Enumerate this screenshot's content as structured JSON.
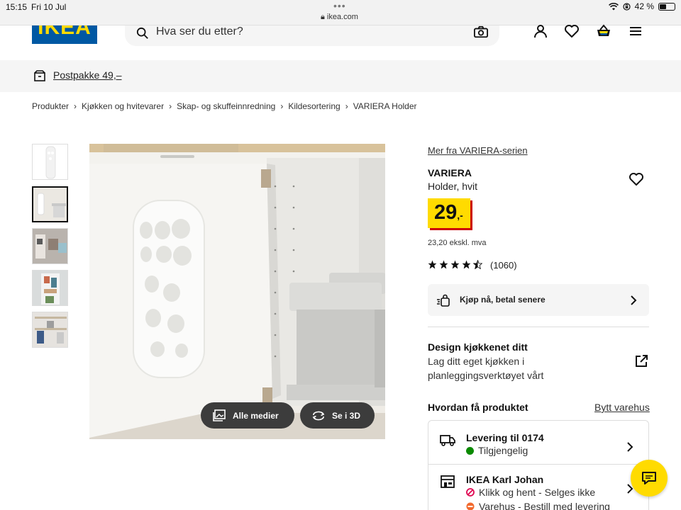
{
  "status_bar": {
    "time": "15:15",
    "date": "Fri 10 Jul",
    "url": "ikea.com",
    "battery": "42 %",
    "icons": [
      "more-dots-icon",
      "lock-icon",
      "wifi-icon",
      "orientation-lock-icon",
      "battery-icon"
    ]
  },
  "header": {
    "logo_text": "IKEA",
    "search_placeholder": "Hva ser du etter?",
    "icons": [
      "search-icon",
      "camera-icon",
      "account-icon",
      "wishlist-icon",
      "basket-icon",
      "menu-icon"
    ]
  },
  "promo": {
    "text": "Postpakke 49,–",
    "icon": "parcel-icon"
  },
  "breadcrumb": [
    "Produkter",
    "Kjøkken og hvitevarer",
    "Skap- og skuffeinnredning",
    "Kildesortering",
    "VARIERA Holder"
  ],
  "gallery": {
    "thumbnail_count": 5,
    "active_thumbnail": 2,
    "all_media_label": "Alle medier",
    "view_3d_label": "Se i 3D"
  },
  "product": {
    "series_link": "Mer fra VARIERA-serien",
    "name": "VARIERA",
    "description": "Holder, hvit",
    "price_main": "29",
    "price_suffix": ",-",
    "price_excl": "23,20 ekskl. mva",
    "rating": 4.5,
    "review_count": "(1060)"
  },
  "klarna": {
    "label": "Kjøp nå, betal senere"
  },
  "design": {
    "title": "Design kjøkkenet ditt",
    "text": "Lag ditt eget kjøkken i planleggingsverktøyet vårt"
  },
  "availability": {
    "heading": "Hvordan få produktet",
    "change_store": "Bytt varehus",
    "delivery_title": "Levering til 0174",
    "delivery_status": "Tilgjengelig",
    "store_title": "IKEA Karl Johan",
    "store_status_1": "Klikk og hent - Selges ikke",
    "store_status_2": "Varehus - Bestill med levering"
  },
  "colors": {
    "ikea_blue": "#0058a3",
    "ikea_yellow": "#ffdb00",
    "price_shadow": "#cc0008",
    "available_green": "#0a8a00",
    "unavailable_red": "#e00751",
    "warning_orange": "#f26a2e"
  }
}
